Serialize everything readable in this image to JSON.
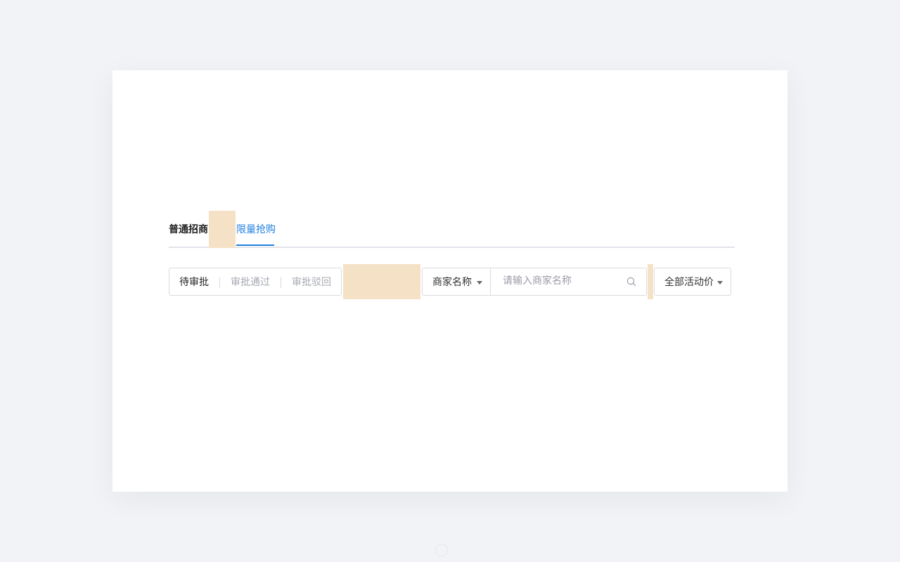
{
  "tabs": [
    {
      "label": "普通招商",
      "active": false
    },
    {
      "label": "限量抢购",
      "active": true
    }
  ],
  "status_segments": [
    {
      "label": "待审批",
      "active": true
    },
    {
      "label": "审批通过",
      "active": false
    },
    {
      "label": "审批驳回",
      "active": false
    }
  ],
  "search": {
    "field_selected": "商家名称",
    "placeholder": "请输入商家名称",
    "value": "",
    "icon": "search-icon"
  },
  "price_filter": {
    "selected": "全部活动价"
  },
  "colors": {
    "accent": "#1f7fe0",
    "background": "#f2f3f6",
    "card": "#ffffff",
    "highlight": "#f5e2c6",
    "border": "#d9dbe1",
    "muted_text": "#a6a9b2"
  }
}
